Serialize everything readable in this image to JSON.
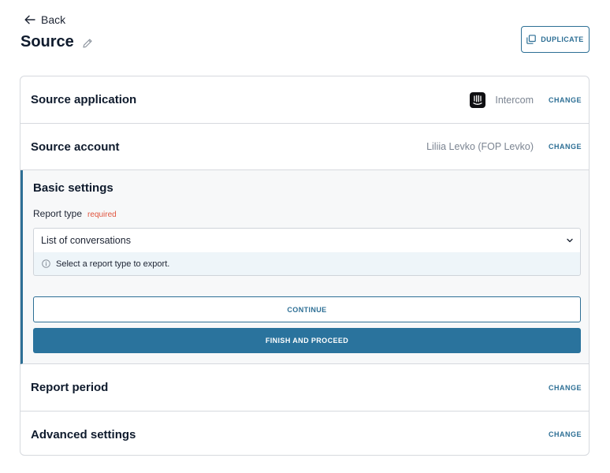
{
  "header": {
    "back_label": "Back",
    "title": "Source",
    "duplicate_label": "DUPLICATE"
  },
  "sections": {
    "source_application": {
      "title": "Source application",
      "value": "Intercom",
      "change": "CHANGE"
    },
    "source_account": {
      "title": "Source account",
      "value": "Liliia Levko (FOP Levko)",
      "change": "CHANGE"
    },
    "basic_settings": {
      "title": "Basic settings",
      "report_type_label": "Report type",
      "required_label": "required",
      "report_type_value": "List of conversations",
      "hint": "Select a report type to export.",
      "continue_label": "CONTINUE",
      "finish_label": "FINISH AND PROCEED"
    },
    "report_period": {
      "title": "Report period",
      "change": "CHANGE"
    },
    "advanced_settings": {
      "title": "Advanced settings",
      "change": "CHANGE"
    }
  },
  "colors": {
    "accent": "#2d6f95",
    "required": "#e0533d",
    "active_bg": "#f7f8f9"
  },
  "icons": [
    "arrow-left-icon",
    "pencil-icon",
    "duplicate-icon",
    "intercom-logo-icon",
    "chevron-down-icon",
    "info-icon"
  ]
}
